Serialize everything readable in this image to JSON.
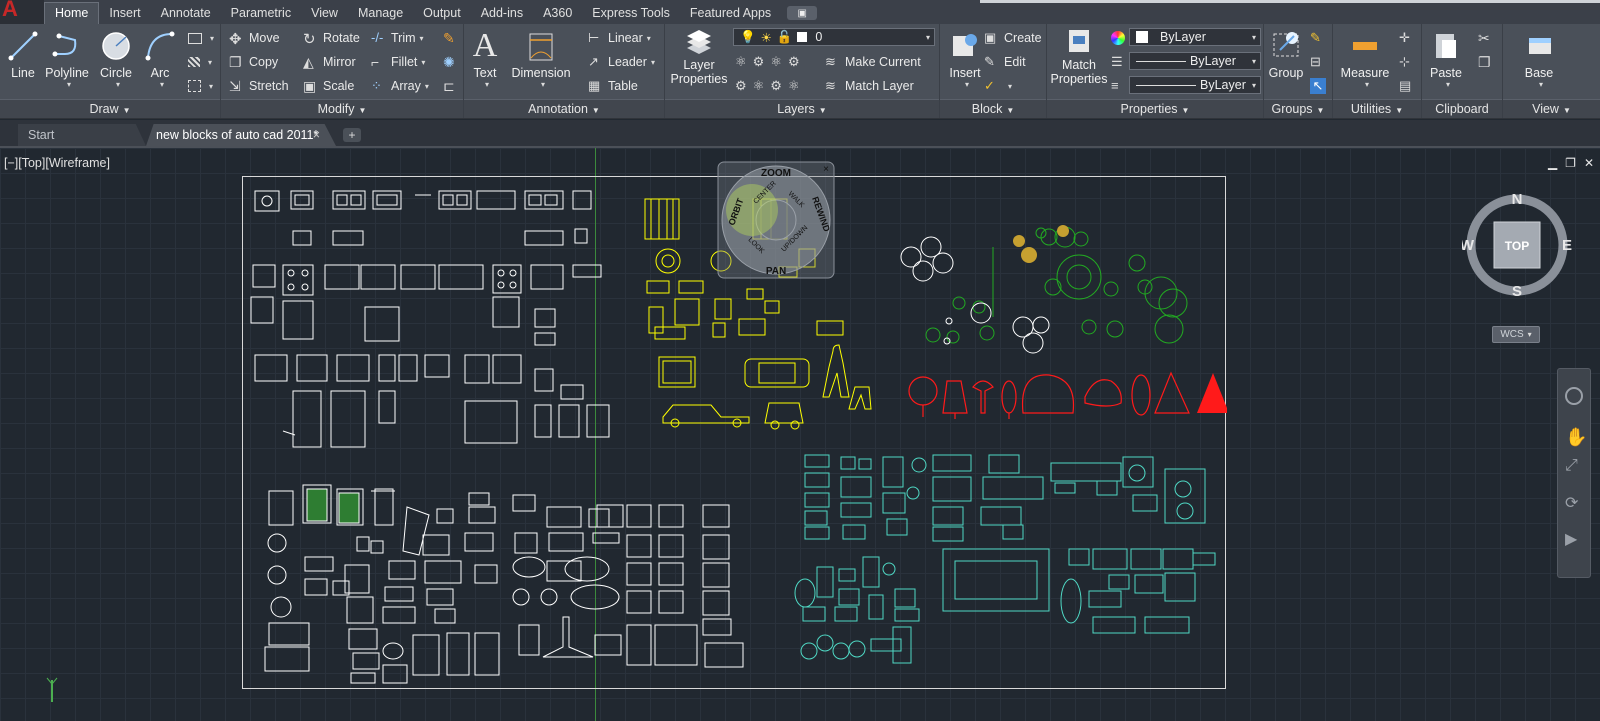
{
  "app": {
    "logo": "A"
  },
  "ribbon_tabs": [
    "Home",
    "Insert",
    "Annotate",
    "Parametric",
    "View",
    "Manage",
    "Output",
    "Add-ins",
    "A360",
    "Express Tools",
    "Featured Apps"
  ],
  "ribbon_tab_extra": "▣",
  "draw": {
    "title": "Draw",
    "line": "Line",
    "polyline": "Polyline",
    "circle": "Circle",
    "arc": "Arc"
  },
  "modify": {
    "title": "Modify",
    "move": "Move",
    "rotate": "Rotate",
    "trim": "Trim",
    "copy": "Copy",
    "mirror": "Mirror",
    "fillet": "Fillet",
    "stretch": "Stretch",
    "scale": "Scale",
    "array": "Array"
  },
  "annotation": {
    "title": "Annotation",
    "text": "Text",
    "dimension": "Dimension",
    "linear": "Linear",
    "leader": "Leader",
    "table": "Table"
  },
  "layers": {
    "title": "Layers",
    "layer_properties_1": "Layer",
    "layer_properties_2": "Properties",
    "current_layer": "0",
    "make_current": "Make Current",
    "match_layer": "Match Layer"
  },
  "block": {
    "title": "Block",
    "insert": "Insert",
    "create": "Create",
    "edit": "Edit"
  },
  "properties": {
    "title": "Properties",
    "match_1": "Match",
    "match_2": "Properties",
    "color": "ByLayer",
    "linetype": "ByLayer",
    "lineweight": "ByLayer"
  },
  "groups": {
    "title": "Groups",
    "group": "Group"
  },
  "utilities": {
    "title": "Utilities",
    "measure": "Measure"
  },
  "clipboard": {
    "title": "Clipboard",
    "paste": "Paste"
  },
  "view": {
    "title": "View",
    "base": "Base"
  },
  "doc_tabs": {
    "start": "Start",
    "doc": "new blocks of auto cad 2011*",
    "close": "×",
    "new": "+"
  },
  "viewport": {
    "label": "[−][Top][Wireframe]",
    "min": "▁",
    "restore": "❐",
    "close": "✕"
  },
  "viewcube": {
    "n": "N",
    "s": "S",
    "e": "E",
    "w": "W",
    "face": "TOP",
    "wcs": "WCS"
  },
  "wheel": {
    "zoom": "ZOOM",
    "orbit": "ORBIT",
    "rewind": "REWIND",
    "pan": "PAN",
    "center": "CENTER",
    "walk": "WALK",
    "look": "LOOK",
    "up_down": "UP/DOWN",
    "close": "×"
  },
  "colors": {
    "white_blocks": "#ffffff",
    "yellow_blocks": "#ffff00",
    "green_blocks": "#22aa22",
    "red_blocks": "#ff1a1a",
    "cyan_blocks": "#4fd8c4",
    "grid": "#2a323c",
    "background": "#212830"
  }
}
